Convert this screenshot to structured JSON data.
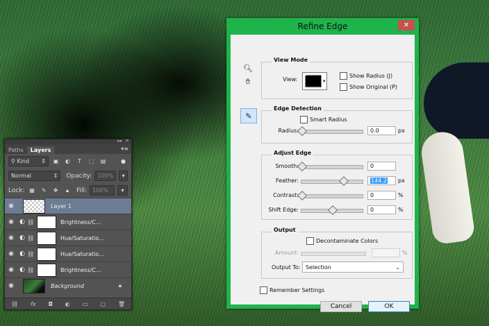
{
  "layers_panel": {
    "collapse_label": "◂◂",
    "close_label": "✕",
    "tabs": [
      {
        "label": "Paths"
      },
      {
        "label": "Layers"
      }
    ],
    "menu_label": "▾≡",
    "filter": {
      "kind_label": "Kind"
    },
    "blend_mode": "Normal",
    "opacity": {
      "label": "Opacity:",
      "value": "100%"
    },
    "lock": {
      "label": "Lock:"
    },
    "fill": {
      "label": "Fill:",
      "value": "100%"
    },
    "layers": [
      {
        "name": "Layer 1"
      },
      {
        "name": "Brightness/C..."
      },
      {
        "name": "Hue/Saturatio..."
      },
      {
        "name": "Hue/Saturatio..."
      },
      {
        "name": "Brightness/C..."
      },
      {
        "name": "Background"
      }
    ]
  },
  "dialog": {
    "title": "Refine Edge",
    "close_label": "✕",
    "accent_color": "#1eb34b",
    "view_mode": {
      "title": "View Mode",
      "view_label": "View:",
      "show_radius_label": "Show Radius (J)",
      "show_original_label": "Show Original (P)"
    },
    "edge_detection": {
      "title": "Edge Detection",
      "smart_radius_label": "Smart Radius",
      "radius_label": "Radius:",
      "radius_value": "0.0",
      "radius_unit": "px",
      "radius_slider_level": 0
    },
    "adjust_edge": {
      "title": "Adjust Edge",
      "smooth_label": "Smooth:",
      "smooth_value": "0",
      "smooth_slider_level": 0,
      "feather_label": "Feather:",
      "feather_value": "144.2",
      "feather_unit": "px",
      "feather_slider_level": 0.68,
      "contrast_label": "Contrast:",
      "contrast_value": "0",
      "contrast_unit": "%",
      "contrast_slider_level": 0,
      "shift_edge_label": "Shift Edge:",
      "shift_edge_value": "0",
      "shift_edge_unit": "%",
      "shift_edge_slider_level": 0.5
    },
    "output": {
      "title": "Output",
      "decontaminate_label": "Decontaminate Colors",
      "amount_label": "Amount:",
      "amount_unit": "%",
      "output_to_label": "Output To:",
      "output_to_value": "Selection"
    },
    "remember_settings_label": "Remember Settings",
    "cancel_label": "Cancel",
    "ok_label": "OK"
  }
}
